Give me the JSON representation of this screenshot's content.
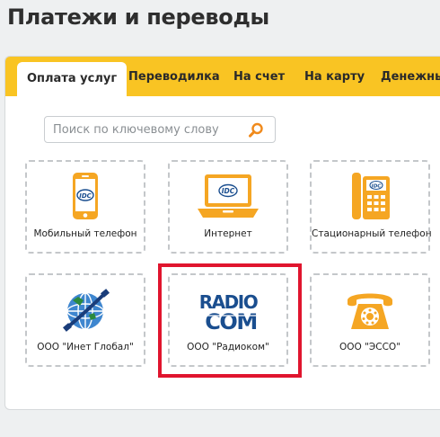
{
  "page": {
    "title": "Платежи и переводы"
  },
  "tabs": [
    {
      "label": "Оплата услуг",
      "active": true
    },
    {
      "label": "Переводилка",
      "active": false
    },
    {
      "label": "На счет",
      "active": false
    },
    {
      "label": "На карту",
      "active": false
    },
    {
      "label": "Денежные",
      "active": false
    }
  ],
  "search": {
    "placeholder": "Поиск по ключевому слову",
    "icon": "search-icon"
  },
  "services": [
    {
      "label": "Мобильный телефон",
      "icon": "mobile-phone-icon"
    },
    {
      "label": "Интернет",
      "icon": "laptop-icon"
    },
    {
      "label": "Стационарный телефон",
      "icon": "desk-phone-icon"
    },
    {
      "label": "ООО \"Инет Глобал\"",
      "icon": "globe-logo"
    },
    {
      "label": "ООО \"Радиоком\"",
      "icon": "radiocom-logo",
      "logo_text": [
        "RADIO",
        "COM"
      ],
      "highlighted": true
    },
    {
      "label": "ООО \"ЭССО\"",
      "icon": "rotary-phone-icon"
    }
  ],
  "colors": {
    "accent": "#f9c423",
    "icon_orange": "#f5a623",
    "highlight": "#e0152e",
    "logo_blue": "#1a4e8f"
  }
}
